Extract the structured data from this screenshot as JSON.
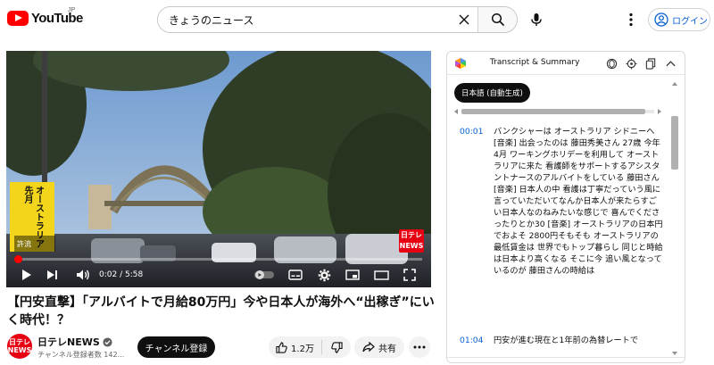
{
  "header": {
    "logo_text": "YouTube",
    "logo_region": "JP",
    "search_value": "きょうのニュース",
    "login_label": "ログイン"
  },
  "player": {
    "overlay_text_1": "オーストラリア",
    "overlay_text_2": "先月",
    "overlay_small": "許流",
    "badge_line1": "日テレ",
    "badge_line2": "NEWS",
    "current_time": "0:02 / 5:58",
    "progress_fraction": 0.006
  },
  "video": {
    "title": "【円安直撃】「アルバイトで月給80万円」今や日本人が海外へ“出稼ぎ”にいく時代！？",
    "channel_name": "日テレNEWS",
    "channel_avatar_line1": "日テレ",
    "channel_avatar_line2": "NEWS",
    "subscribers": "チャンネル登録者数 142...",
    "subscribe_label": "チャンネル登録",
    "like_count": "1.2万",
    "share_label": "共有"
  },
  "panel": {
    "title": "Transcript & Summary",
    "language_label": "日本語 (自動生成)",
    "segments": [
      {
        "time": "00:01",
        "text": "バンクシャーは オーストラリア シドニーへ [音楽] 出会ったのは 藤田秀美さん 27歳 今年4月 ワーキングホリデーを利用して オーストラリアに来た 看護師をサポートするアシスタントナースのアルバイトをしている 藤田さん [音楽] 日本人の中 看護は丁寧だっていう風に 言っていただいてなんか日本人が来たらすごい日本人なのねみたいな感じで 喜んでくださったりとか30 [音楽] オーストラリアの日本円でおよそ 2800円そもそも オーストラリアの最低賃金は 世界でもトップ暮らし 同じと時給は日本より高くなる そこに今 追い風となっているのが 藤田さんの時給は"
      },
      {
        "time": "01:04",
        "text": "円安が進む現在と1年前の為替レートで"
      }
    ]
  },
  "colors": {
    "brand_red": "#ff0000",
    "link_blue": "#065fd4",
    "ntv_red": "#e60012",
    "banner_yellow": "#f3d61c"
  }
}
